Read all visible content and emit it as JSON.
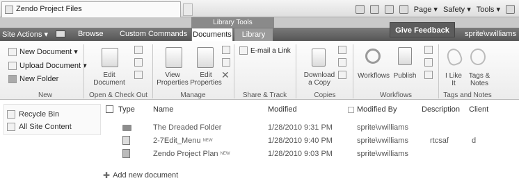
{
  "browser": {
    "tab_title": "Zendo Project Files",
    "commands": {
      "page": "Page ▾",
      "safety": "Safety ▾",
      "tools": "Tools ▾"
    }
  },
  "header": {
    "site_actions": "Site Actions ▾",
    "browse": "Browse",
    "custom_commands": "Custom Commands",
    "library_tools": "Library Tools",
    "tab_documents": "Documents",
    "tab_library": "Library",
    "give_feedback": "Give Feedback",
    "user": "sprite\\vwilliams"
  },
  "ribbon": {
    "new_group": {
      "new_document": "New Document ▾",
      "upload_document": "Upload Document ▾",
      "new_folder": "New Folder",
      "label": "New"
    },
    "open_checkout": {
      "edit_document": "Edit Document",
      "label": "Open & Check Out"
    },
    "manage": {
      "view_properties": "View Properties",
      "edit_properties": "Edit Properties",
      "label": "Manage"
    },
    "share_track": {
      "email_link": "E-mail a Link",
      "label": "Share & Track"
    },
    "copies": {
      "download_copy": "Download a Copy",
      "label": "Copies"
    },
    "workflows": {
      "workflows": "Workflows",
      "publish": "Publish",
      "label": "Workflows"
    },
    "tags_notes": {
      "i_like_it": "I Like It",
      "tags_notes": "Tags & Notes",
      "label": "Tags and Notes"
    }
  },
  "leftnav": {
    "recycle_bin": "Recycle Bin",
    "all_site_content": "All Site Content"
  },
  "list": {
    "columns": [
      "Type",
      "Name",
      "Modified",
      "Modified By",
      "Description",
      "Client"
    ],
    "rows": [
      {
        "type": "folder",
        "name": "The Dreaded Folder",
        "new": "",
        "modified": "1/28/2010 9:31 PM",
        "by": "sprite\\vwilliams",
        "description": "",
        "client": ""
      },
      {
        "type": "document",
        "name": "2-7Edit_Menu",
        "new": "NEW",
        "modified": "1/28/2010 9:40 PM",
        "by": "sprite\\vwilliams",
        "description": "rtcsaf",
        "client": "d"
      },
      {
        "type": "project",
        "name": "Zendo Project Plan",
        "new": "NEW",
        "modified": "1/28/2010 9:03 PM",
        "by": "sprite\\vwilliams",
        "description": "",
        "client": ""
      }
    ],
    "add_new": "Add new document"
  }
}
